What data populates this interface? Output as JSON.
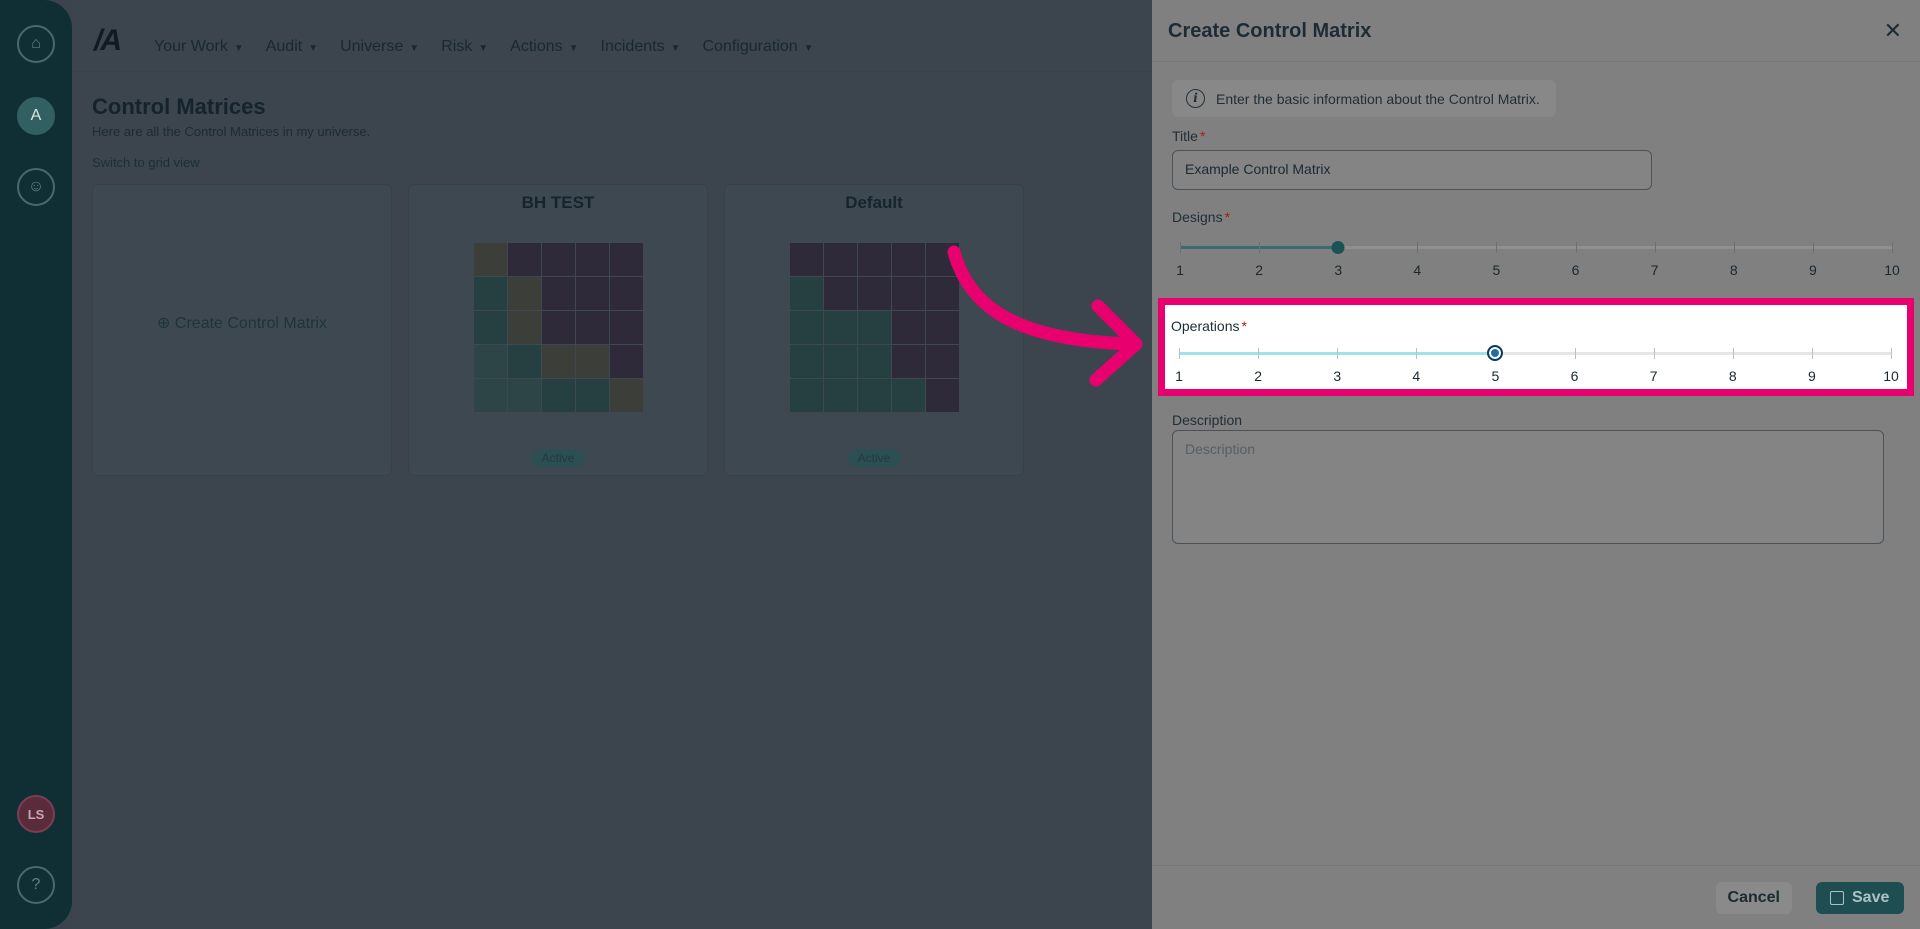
{
  "rail": {
    "avatar_initials": "LS",
    "icons": [
      "home-icon",
      "logo-icon",
      "user-settings-icon",
      "help-icon"
    ],
    "help_glyph": "?"
  },
  "nav": {
    "items": [
      "Your Work",
      "Audit",
      "Universe",
      "Risk",
      "Actions",
      "Incidents",
      "Configuration"
    ]
  },
  "page": {
    "title": "Control Matrices",
    "subtitle": "Here are all the Control Matrices in my universe.",
    "grid_link": "Switch to grid view",
    "create_label": "Create Control Matrix",
    "cards": [
      {
        "title": "BH TEST",
        "status": "Active"
      },
      {
        "title": "Default",
        "status": "Active"
      }
    ]
  },
  "drawer": {
    "title": "Create Control Matrix",
    "info": "Enter the basic information about the Control Matrix.",
    "title_label": "Title",
    "title_value": "Example Control Matrix",
    "designs_label": "Designs",
    "designs_value": 3,
    "operations_label": "Operations",
    "operations_value": 5,
    "scale": [
      "1",
      "2",
      "3",
      "4",
      "5",
      "6",
      "7",
      "8",
      "9",
      "10"
    ],
    "description_label": "Description",
    "description_placeholder": "Description",
    "cancel": "Cancel",
    "save": "Save",
    "required_mark": "*"
  },
  "colors": {
    "highlight": "#e8006f",
    "accent": "#1f4e52"
  }
}
